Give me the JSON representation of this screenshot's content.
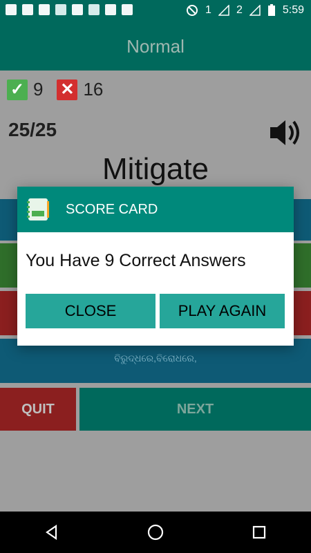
{
  "status": {
    "sim1": "1",
    "sim2": "2",
    "time": "5:59"
  },
  "app_bar": {
    "title": "Normal"
  },
  "score": {
    "correct": "9",
    "wrong": "16"
  },
  "progress": "25/25",
  "word": "Mitigate",
  "options": [
    {
      "text": ""
    },
    {
      "text": ""
    },
    {
      "text": ""
    },
    {
      "text": "ବିରୁଦ୍ଧରେ,ବିରୋଧରେ,"
    }
  ],
  "buttons": {
    "quit": "QUIT",
    "next": "NEXT"
  },
  "dialog": {
    "title": "SCORE CARD",
    "message": "You Have 9 Correct Answers",
    "close_label": "CLOSE",
    "play_again_label": "PLAY AGAIN"
  },
  "icons": {
    "correct": "check-icon",
    "wrong": "x-icon",
    "speaker": "speaker-icon",
    "back": "back-triangle-icon",
    "home": "home-circle-icon",
    "recents": "recents-square-icon"
  },
  "colors": {
    "primary": "#00695c",
    "dialog_header": "#00897b",
    "button": "#26a69a",
    "correct": "#4caf50",
    "wrong": "#d32f2f"
  }
}
